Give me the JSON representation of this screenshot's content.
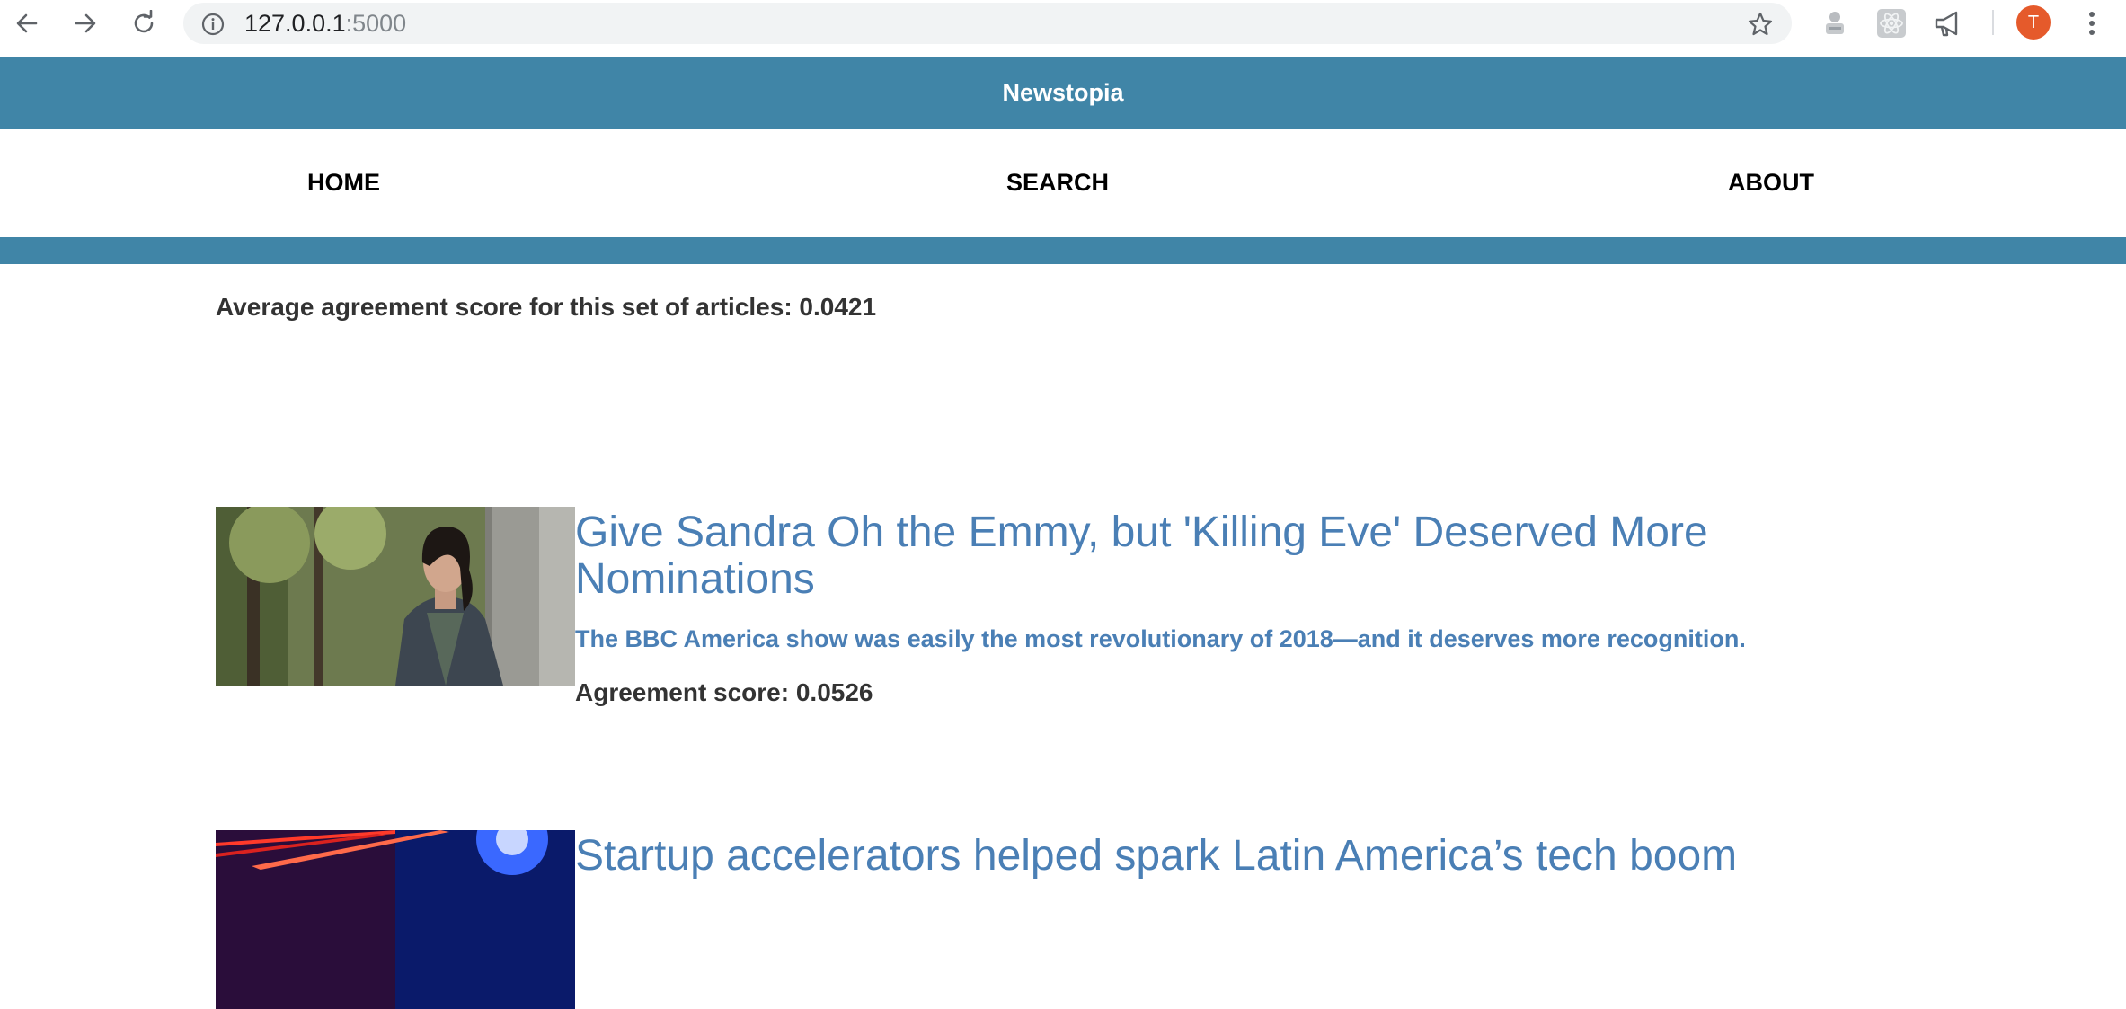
{
  "browser": {
    "url_host": "127.0.0.1",
    "url_port": ":5000",
    "profile_initial": "T"
  },
  "site": {
    "name": "Newstopia",
    "accent_color": "#4085a7",
    "link_color": "#4a7fb5",
    "nav": {
      "home": "HOME",
      "search": "SEARCH",
      "about": "ABOUT"
    }
  },
  "summary": {
    "average_label": "Average agreement score for this set of articles: 0.0421"
  },
  "articles": [
    {
      "title": "Give Sandra Oh the Emmy, but 'Killing Eve' Deserved More Nominations",
      "subtitle": "The BBC America show was easily the most revolutionary of 2018—and it deserves more recognition.",
      "score_label": "Agreement score: 0.0526",
      "image_icon": "woman-in-dark-jacket-photo"
    },
    {
      "title": "Startup accelerators helped spark Latin America’s tech boom",
      "image_icon": "red-blue-light-streaks-photo"
    }
  ]
}
